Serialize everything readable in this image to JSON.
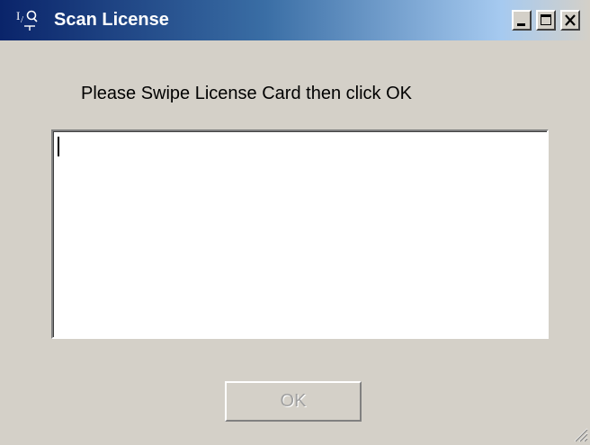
{
  "window": {
    "title": "Scan License",
    "app_icon": "iq-app-icon",
    "controls": {
      "minimize_icon": "minimize-icon",
      "maximize_icon": "maximize-icon",
      "close_icon": "close-icon"
    }
  },
  "content": {
    "prompt": "Please Swipe License Card then click OK",
    "license_input_value": ""
  },
  "buttons": {
    "ok_label": "OK",
    "ok_enabled": false
  },
  "colors": {
    "titlebar_start": "#0a246a",
    "titlebar_end": "#a6caf0",
    "dialog_background": "#d4d0c8",
    "disabled_text": "#a0a0a0"
  }
}
